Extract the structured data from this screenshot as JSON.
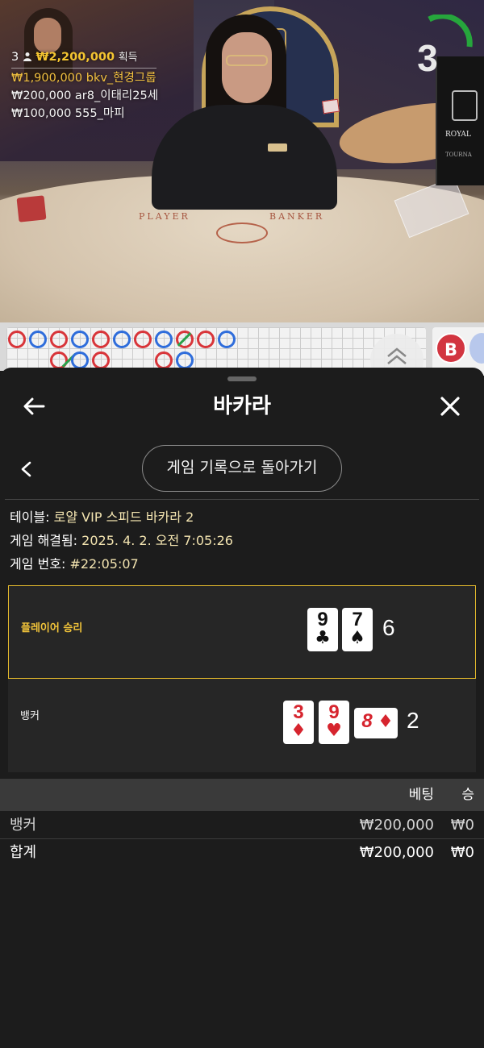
{
  "stream": {
    "countdown": "3",
    "winners": {
      "count": "3",
      "total": "₩2,200,000",
      "total_label": "획득",
      "list": [
        {
          "amount": "₩1,900,000",
          "name": "bkv_현경그룹"
        },
        {
          "amount": "₩200,000",
          "name": "ar8_이태리25세"
        },
        {
          "amount": "₩100,000",
          "name": "555_마피"
        }
      ]
    },
    "table_markings": {
      "player": "PLAYER",
      "banker": "BANKER"
    },
    "side_board": {
      "brand": "ROYAL",
      "sub": "TOURNA"
    },
    "roadmap_badge": "B"
  },
  "sheet": {
    "title": "바카라",
    "back_to_history_label": "게임 기록으로 돌아가기",
    "info": {
      "table_label": "테이블:",
      "table_value": "로얄 VIP 스피드 바카라 2",
      "resolved_label": "게임 해결됨:",
      "resolved_value": "2025. 4. 2. 오전 7:05:26",
      "game_no_label": "게임 번호:",
      "game_no_value": "#22:05:07"
    },
    "player": {
      "label": "플레이어 승리",
      "cards": [
        {
          "rank": "9",
          "suit": "♣"
        },
        {
          "rank": "7",
          "suit": "♠"
        }
      ],
      "score": "6"
    },
    "banker": {
      "label": "뱅커",
      "cards": [
        {
          "rank": "3",
          "suit": "♦"
        },
        {
          "rank": "9",
          "suit": "♥"
        },
        {
          "rank": "8",
          "suit": "♦"
        }
      ],
      "score": "2"
    },
    "bets": {
      "col_bet": "베팅",
      "col_win": "승",
      "rows": [
        {
          "label": "뱅커",
          "amount": "₩200,000",
          "win": "₩0"
        },
        {
          "label": "합계",
          "amount": "₩200,000",
          "win": "₩0"
        }
      ]
    }
  },
  "colors": {
    "gold": "#f3c53a",
    "player_border": "#e2b82c",
    "banker_red": "#d23540",
    "player_blue": "#2f6ddb",
    "sheet_bg": "#1c1c1c"
  }
}
